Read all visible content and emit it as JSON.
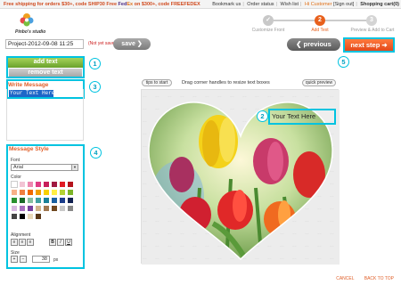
{
  "topbar": {
    "promo_part1": "Free shipping for orders $30+, code SHIP30",
    "promo_free": "Free",
    "promo_fed": "Fed",
    "promo_ex": "Ex",
    "promo_part2": "on $300+, code FREEFEDEX",
    "links": [
      "Bookmark us",
      "Order status",
      "Wish list"
    ],
    "customer_text": "Hi Customer",
    "signout": "[Sign out]",
    "cart": "Shopping cart(0)"
  },
  "logo": {
    "text": "Pinbo's studio",
    "icon": "flower-logo-icon"
  },
  "steps": [
    {
      "num": "✓",
      "label": "Customize Front",
      "state": "done"
    },
    {
      "num": "2",
      "label": "Add Text",
      "state": "active"
    },
    {
      "num": "3",
      "label": "Preview & Add to Cart",
      "state": "pending"
    }
  ],
  "project": {
    "name": "Project-2012-09-08 11:25",
    "status": "(Not yet saved)"
  },
  "buttons": {
    "save": "save ❯",
    "previous": "❮ previous",
    "next": "next step ➜",
    "add_text": "add text",
    "remove_text": "remove text",
    "tips": "tips to start",
    "quick_preview": "quick preview"
  },
  "canvas": {
    "instruction": "Drag corner handles to resize text boxes",
    "text_box": "Your Text Here"
  },
  "write_message": {
    "title": "Write Message",
    "value": "Your Text Here"
  },
  "message_style": {
    "title": "Message Style",
    "font_label": "Font",
    "font_value": "Arial",
    "color_label": "Color",
    "alignment_label": "Alignment",
    "size_label": "Size",
    "size_value": "38",
    "size_unit": "px",
    "size_plus": "+",
    "size_minus": "−",
    "align_buttons": [
      "≡",
      "≡",
      "≡"
    ],
    "style_buttons": [
      "B",
      "I",
      "U"
    ]
  },
  "colors": [
    "#ffffff",
    "#f2c4d4",
    "#ee88b0",
    "#e03c84",
    "#c81e5a",
    "#a01840",
    "#e01c24",
    "#b4141c",
    "#f8b088",
    "#f08040",
    "#f06a00",
    "#f0a000",
    "#f8d000",
    "#ffee44",
    "#b4d234",
    "#7cb428",
    "#2a9030",
    "#1a6a2a",
    "#88c0a0",
    "#40a0a0",
    "#1a8098",
    "#1a60a0",
    "#1a3c8a",
    "#102050",
    "#d8b8e0",
    "#a870c0",
    "#7840a0",
    "#d2b48c",
    "#a07850",
    "#704820",
    "#c8c8c8",
    "#888888",
    "#444444",
    "#000000",
    "#e8d8b8",
    "#5a3818"
  ],
  "annotations": [
    "1",
    "2",
    "3",
    "4",
    "5"
  ],
  "bottom_links": {
    "cancel": "CANCEL",
    "back_to_top": "BACK TO TOP"
  }
}
